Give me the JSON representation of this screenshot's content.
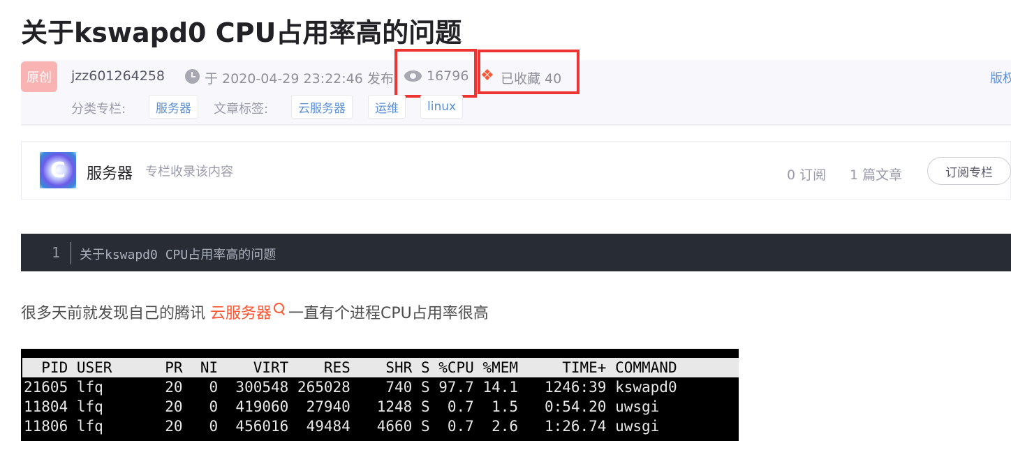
{
  "article": {
    "title": "关于kswapd0 CPU占用率高的问题",
    "badge": "原创",
    "author": "jzz601264258",
    "publish": "于 2020-04-29 23:22:46 发布",
    "views": "16796",
    "favorites": "已收藏 40",
    "copyright": "版权",
    "category_label": "分类专栏:",
    "category_tags": [
      "服务器"
    ],
    "article_tags_label": "文章标签:",
    "article_tags": [
      "云服务器",
      "运维",
      "linux"
    ]
  },
  "column": {
    "name": "服务器",
    "desc": "专栏收录该内容",
    "subscribers": "0 订阅",
    "articles": "1 篇文章",
    "subscribe_button": "订阅专栏"
  },
  "code": {
    "line_number": "1",
    "text": "关于kswapd0 CPU占用率高的问题"
  },
  "paragraph": {
    "before": "很多天前就发现自己的腾讯 ",
    "link": "云服务器",
    "after": "一直有个进程CPU占用率很高"
  },
  "terminal": {
    "header": "  PID USER      PR  NI    VIRT    RES    SHR S %CPU %MEM     TIME+ COMMAND",
    "rows": [
      "21605 lfq       20   0  300548 265028    740 S 97.7 14.1   1246:39 kswapd0",
      "11804 lfq       20   0  419060  27940   1248 S  0.7  1.5   0:54.20 uwsgi",
      "11806 lfq       20   0  456016  49484   4660 S  0.7  2.6   1:26.74 uwsgi"
    ]
  },
  "icons": {
    "clock": "clock-icon",
    "eye": "eye-icon",
    "favorite": "favorite-icon",
    "search": "search-icon"
  },
  "colors": {
    "accent": "#fc5531",
    "link": "#5a8fd6",
    "highlight_box": "#ee3333",
    "code_bg": "#282c34"
  }
}
